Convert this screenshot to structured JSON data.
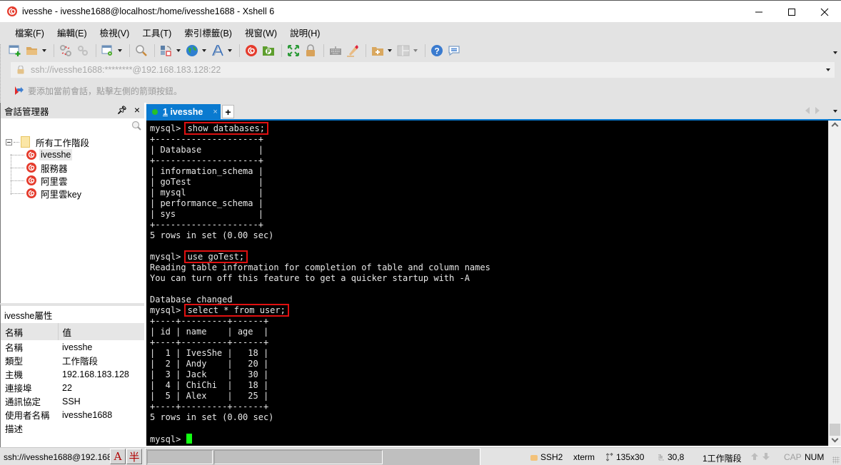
{
  "window": {
    "title": "ivesshe - ivesshe1688@localhost:/home/ivesshe1688 - Xshell 6",
    "minimize": "minimize",
    "maximize": "maximize",
    "close": "close"
  },
  "menu": [
    {
      "label": "檔案(F)"
    },
    {
      "label": "編輯(E)"
    },
    {
      "label": "檢視(V)"
    },
    {
      "label": "工具(T)"
    },
    {
      "label": "索引標籤(B)"
    },
    {
      "label": "視窗(W)"
    },
    {
      "label": "說明(H)"
    }
  ],
  "toolbar": {
    "icons": [
      "new-session-icon",
      "open-folder-icon",
      "disconnect-icon",
      "reconnect-icon",
      "session-properties-icon",
      "find-icon",
      "transfer-layout-icon",
      "globe-icon",
      "font-icon",
      "xshell-icon",
      "xftp-icon",
      "fullscreen-icon",
      "lock-icon",
      "keyboard-icon",
      "highlight-icon",
      "new-folder-icon",
      "layout-icon",
      "help-icon",
      "chat-icon"
    ]
  },
  "address": {
    "value": "ssh://ivesshe1688:********@192.168.183.128:22"
  },
  "hint": {
    "text": "要添加當前會話，點擊左側的箭頭按鈕。"
  },
  "session_manager": {
    "title": "會話管理器",
    "search_placeholder": "",
    "root_label": "所有工作階段",
    "sessions": [
      {
        "label": "ivesshe",
        "selected": true
      },
      {
        "label": "服務器",
        "selected": false
      },
      {
        "label": "阿里雲",
        "selected": false
      },
      {
        "label": "阿里雲key",
        "selected": false
      }
    ]
  },
  "properties": {
    "title": "ivesshe屬性",
    "col_name": "名稱",
    "col_value": "值",
    "rows": [
      {
        "name": "名稱",
        "value": "ivesshe"
      },
      {
        "name": "類型",
        "value": "工作階段"
      },
      {
        "name": "主機",
        "value": "192.168.183.128"
      },
      {
        "name": "連接埠",
        "value": "22"
      },
      {
        "name": "通訊協定",
        "value": "SSH"
      },
      {
        "name": "使用者名稱",
        "value": "ivesshe1688"
      },
      {
        "name": "描述",
        "value": ""
      }
    ]
  },
  "tabs": [
    {
      "number": "1",
      "label": "ivesshe",
      "status_color": "#27c027",
      "close": "×"
    }
  ],
  "tab_add": "+",
  "terminal": {
    "prompt": "mysql> ",
    "lines": [
      {
        "prompt": "mysql> ",
        "cmd": "show databases;",
        "highlight": true
      },
      {
        "text": "+--------------------+"
      },
      {
        "text": "| Database           |"
      },
      {
        "text": "+--------------------+"
      },
      {
        "text": "| information_schema |"
      },
      {
        "text": "| goTest             |"
      },
      {
        "text": "| mysql              |"
      },
      {
        "text": "| performance_schema |"
      },
      {
        "text": "| sys                |"
      },
      {
        "text": "+--------------------+"
      },
      {
        "text": "5 rows in set (0.00 sec)"
      },
      {
        "text": ""
      },
      {
        "prompt": "mysql> ",
        "cmd": "use goTest;",
        "highlight": true
      },
      {
        "text": "Reading table information for completion of table and column names"
      },
      {
        "text": "You can turn off this feature to get a quicker startup with -A"
      },
      {
        "text": ""
      },
      {
        "text": "Database changed"
      },
      {
        "prompt": "mysql> ",
        "cmd": "select * from user;",
        "highlight": true
      },
      {
        "text": "+----+---------+------+"
      },
      {
        "text": "| id | name    | age  |"
      },
      {
        "text": "+----+---------+------+"
      },
      {
        "text": "|  1 | IvesShe |   18 |"
      },
      {
        "text": "|  2 | Andy    |   20 |"
      },
      {
        "text": "|  3 | Jack    |   30 |"
      },
      {
        "text": "|  4 | ChiChi  |   18 |"
      },
      {
        "text": "|  5 | Alex    |   25 |"
      },
      {
        "text": "+----+---------+------+"
      },
      {
        "text": "5 rows in set (0.00 sec)"
      },
      {
        "text": ""
      },
      {
        "prompt": "mysql> ",
        "cmd": "",
        "highlight": false,
        "cursor": true
      }
    ],
    "databases": [
      "information_schema",
      "goTest",
      "mysql",
      "performance_schema",
      "sys"
    ],
    "user_table": {
      "columns": [
        "id",
        "name",
        "age"
      ],
      "rows": [
        [
          1,
          "IvesShe",
          18
        ],
        [
          2,
          "Andy",
          20
        ],
        [
          3,
          "Jack",
          30
        ],
        [
          4,
          "ChiChi",
          18
        ],
        [
          5,
          "Alex",
          25
        ]
      ]
    },
    "cursor_color": "#12ff12",
    "highlight_color": "#e01010"
  },
  "statusbar": {
    "connection": "ssh://ivesshe1688@192.168",
    "ime_mode_1": "A",
    "ime_mode_2": "半",
    "protocol": "SSH2",
    "terminal_type": "xterm",
    "size": "135x30",
    "cursor_pos": "30,8",
    "sessions": "1工作階段",
    "cap": "CAP",
    "num": "NUM"
  },
  "colors": {
    "accent": "#0a7ad0",
    "chrome_bg": "#e3e3e3",
    "terminal_bg": "#000000",
    "terminal_fg": "#e8e8e8"
  }
}
